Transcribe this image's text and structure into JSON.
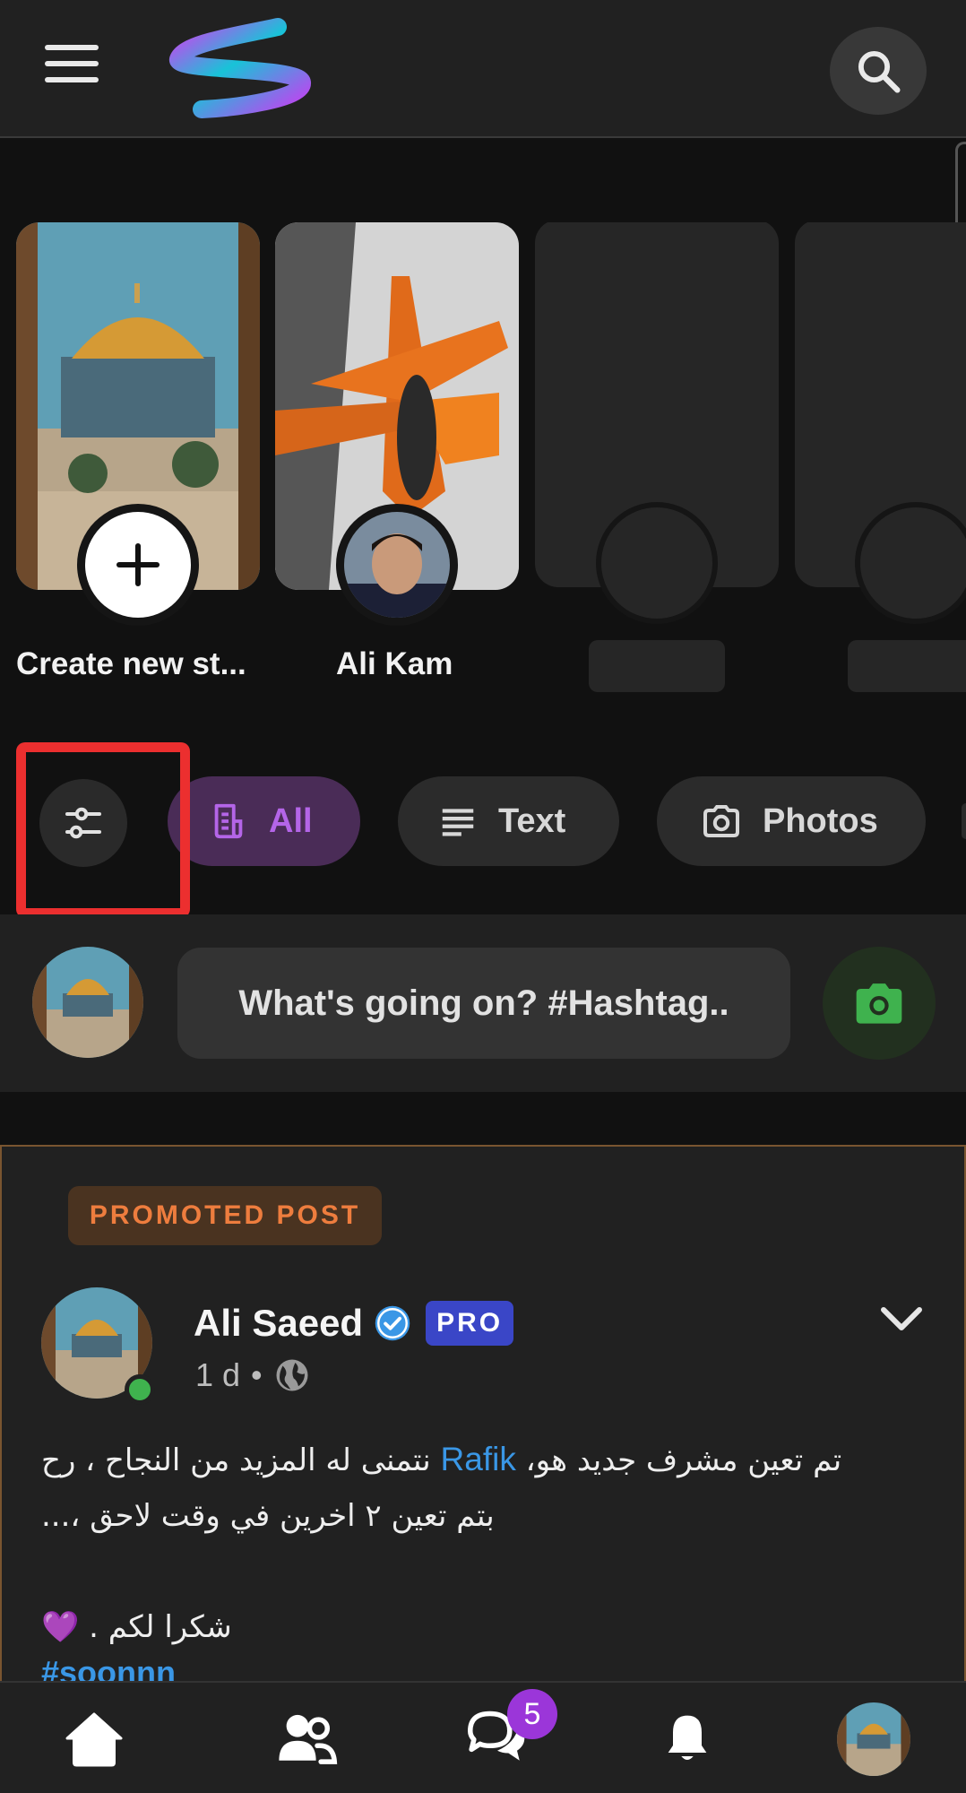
{
  "header": {
    "menu_icon": "hamburger-menu-icon",
    "logo_icon": "app-logo",
    "search_icon": "search-icon"
  },
  "stories": {
    "items": [
      {
        "label": "Create new st...",
        "type": "create"
      },
      {
        "label": "Ali Kam",
        "type": "user"
      },
      {
        "label": "",
        "type": "placeholder"
      },
      {
        "label": "",
        "type": "placeholder"
      }
    ]
  },
  "filters": {
    "filter_icon": "sliders-icon",
    "all_label": "All",
    "text_label": "Text",
    "photos_label": "Photos",
    "active": "All"
  },
  "composer": {
    "placeholder": "What's going on? #Hashtag..",
    "camera_icon": "camera-icon"
  },
  "post": {
    "promoted_label": "PROMOTED POST",
    "author": "Ali Saeed",
    "pro_badge": "PRO",
    "time": "1 d",
    "separator": "•",
    "privacy_icon": "globe-icon",
    "text_line1_before": "تم تعين مشرف جديد هو، ",
    "mention": "Rafik",
    "text_line1_after": " نتمنى له المزيد من النجاح ، رح",
    "text_line2": "بتم تعين ٢ اخرين في وقت لاحق ،...",
    "text_line4": "شكرا لكم . 💜",
    "hashtag": "#soonnn"
  },
  "bottom_nav": {
    "chat_badge": "5"
  },
  "colors": {
    "accent_purple": "#b465e8",
    "link_blue": "#3a97e6",
    "promoted_orange": "#ee7d3e",
    "online_green": "#3fb24e",
    "highlight_red": "#ec2f2f"
  }
}
